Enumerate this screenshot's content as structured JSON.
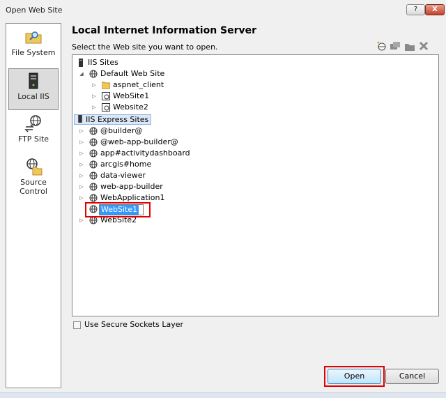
{
  "window": {
    "title": "Open Web Site",
    "help_label": "?",
    "close_label": "X"
  },
  "sidebar": {
    "items": [
      {
        "label": "File System",
        "icon": "folder-search-icon",
        "selected": false
      },
      {
        "label": "Local IIS",
        "icon": "server-icon",
        "selected": true
      },
      {
        "label": "FTP Site",
        "icon": "globe-arrows-icon",
        "selected": false
      },
      {
        "label": "Source Control",
        "icon": "globe-folder-icon",
        "selected": false
      }
    ]
  },
  "main": {
    "title": "Local Internet Information Server",
    "subtitle": "Select the Web site you want to open.",
    "toolbar_icons": [
      "new-site-icon",
      "new-application-icon",
      "new-virtual-directory-icon",
      "delete-icon"
    ]
  },
  "tree": {
    "iis_sites_label": "IIS Sites",
    "default_web_site": "Default Web Site",
    "aspnet_client": "aspnet_client",
    "website1_app": "WebSite1",
    "website2_app": "Website2",
    "iis_express_label": "IIS Express Sites",
    "express_sites": [
      "@builder@",
      "@web-app-builder@",
      "app#activitydashboard",
      "arcgis#home",
      "data-viewer",
      "web-app-builder",
      "WebApplication1"
    ],
    "editing_site": "WebSite1",
    "last_site": "WebSite2"
  },
  "footer": {
    "ssl_label": "Use Secure Sockets Layer",
    "ssl_checked": false,
    "open_label": "Open",
    "cancel_label": "Cancel"
  },
  "colors": {
    "highlight": "#3399ff",
    "annotation_red": "#e00000",
    "selected_bg": "#dcdcdc"
  }
}
